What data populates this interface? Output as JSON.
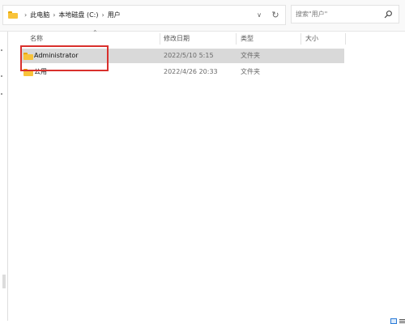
{
  "breadcrumb": {
    "items": [
      {
        "label": "此电脑"
      },
      {
        "label": "本地磁盘 (C:)"
      },
      {
        "label": "用户"
      }
    ],
    "separator": "›"
  },
  "search": {
    "placeholder": "搜索\"用户\""
  },
  "columns": {
    "name": "名称",
    "date": "修改日期",
    "type": "类型",
    "size": "大小"
  },
  "rows": [
    {
      "name": "Administrator",
      "date": "2022/5/10 5:15",
      "type": "文件夹",
      "selected": true
    },
    {
      "name": "公用",
      "date": "2022/4/26 20:33",
      "type": "文件夹",
      "selected": false
    }
  ],
  "colors": {
    "folder": "#f8c33a",
    "folder_tab": "#e8a800",
    "selection": "#d9d9d9",
    "highlight_box": "#d9302c"
  },
  "icons": [
    "folder-icon",
    "chevron-right-icon",
    "chevron-down-icon",
    "refresh-icon",
    "search-icon",
    "sort-up-icon"
  ]
}
